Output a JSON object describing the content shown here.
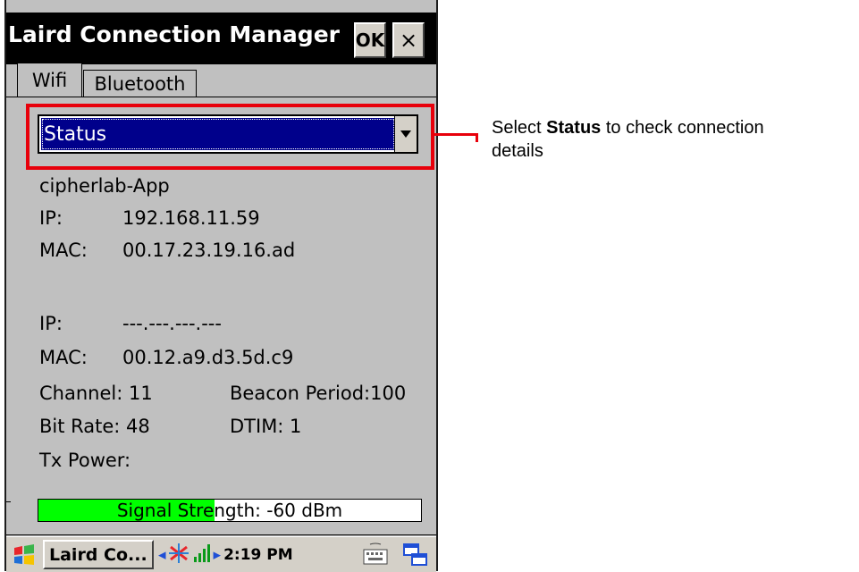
{
  "window": {
    "title": "Laird Connection Manager",
    "ok_label": "OK",
    "close_label": "×"
  },
  "tabs": [
    {
      "label": "Wifi"
    },
    {
      "label": "Bluetooth"
    }
  ],
  "dropdown": {
    "selected": "Status"
  },
  "status": {
    "ssid": "cipherlab-App",
    "ip_label": "IP:",
    "ip_value": "192.168.11.59",
    "mac_label": "MAC:",
    "mac_value": "00.17.23.19.16.ad",
    "ip2_label": "IP:",
    "ip2_value": "---.---.---.---",
    "mac2_label": "MAC:",
    "mac2_value": "00.12.a9.d3.5d.c9",
    "channel": "Channel: 11",
    "beacon": "Beacon Period:100",
    "bitrate": "Bit Rate: 48",
    "dtim": "DTIM: 1",
    "txpower": "Tx Power:",
    "signal_label": "Signal Strength: -60 dBm",
    "signal_fraction": 0.46
  },
  "taskbar": {
    "task_label": "Laird Co...",
    "time": "2:19 PM"
  },
  "callout": {
    "prefix": "Select ",
    "bold": "Status",
    "suffix": " to check connection",
    "line2": "details"
  },
  "colors": {
    "highlight": "#e8000b",
    "selection": "#00008b",
    "signal": "#00ff00"
  }
}
